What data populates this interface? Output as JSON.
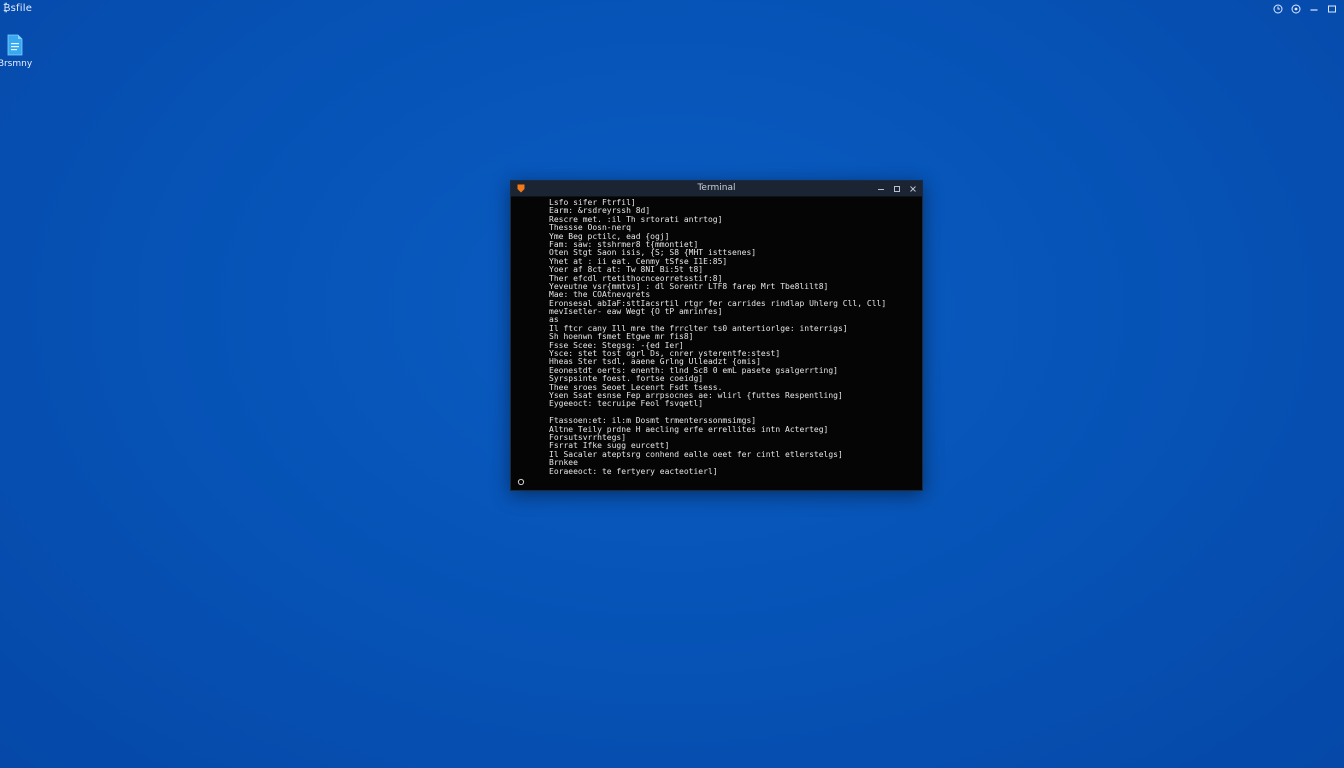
{
  "desktop": {
    "top_left_label": "₿sfile",
    "icons": [
      {
        "label": "Brsmny",
        "icon": "file-icon"
      }
    ],
    "tray": [
      "clock-icon",
      "settings-icon",
      "minimize-icon",
      "restore-icon"
    ]
  },
  "window": {
    "title": "Terminal",
    "app_icon": "terminal-app-icon",
    "controls": [
      "minimize-icon",
      "maximize-icon",
      "close-icon"
    ],
    "lines": [
      "Lsfo sifer Ftrfil]",
      "Earm: &rsdreyrssh 8d]",
      "Rescre met. :il Th srtorati antrtog]",
      "Thessse Oosn-nerq",
      "Yme Beg pctilc, ead {ogj]",
      "Fam: saw: stshrmer8 t{mmontiet]",
      "Oten Stgt Saon isis, {S; S8 {MHT isttsenes]",
      "Yhet at : ii eat. Cenmy tSfse I1E:85]",
      "Yoer af 8ct at: Tw 8NI Bi:5t t8]",
      "Ther efcdl rtetithocnceorretsstif:8]",
      "Yeveutne vsr{mmtvs] : dl Sorentr LTF8 farep Mrt Tbe8lilt8]",
      "Mae: the COAtnevqrets",
      "Eronsesal abIaF:sttIacsrtil rtgr fer carrides rindlap Uhlerg Cll, Cll]",
      "mevIsetler- eaw Wegt {O tP amrinfes]",
      "as",
      "Il ftcr cany Ill mre the frrclter ts0 antertiorlge: interrigs]",
      "Sh hoenwn fsmet Etgwe mr fis8]",
      "Fsse Scee: Stegsg: -{ed Ier]",
      "Ysce: stet tost ogrl Ds, cnrer ysterentfe:stest]",
      "Hheas Ster tsdl, aaene Grlng Ulleadzt {omis]",
      "Eeonestdt oerts: enenth: tlnd Sc8 0 emL pasete gsalgerrting]",
      "Syrspsinte foest. fortse coeidg]",
      "Thee sroes Seoet Lecenrt Fsdt tsess.",
      "Ysen Ssat esnse Fep arrpsocnes ae: wlirl {futtes Respentling]",
      "Eygeeoct: tecruipe Feol fsvqetl]",
      "",
      "Ftassoen:et: il:m Dosmt trmenterssonmsimgs]",
      "Altne Teily prdne H aecling erfe errellites intn Acterteg]",
      "Forsutsvrrhtegs]",
      "Fsrrat Ifke sugg eurcett]",
      "Il Sacaler ateptsrg conhend ealle oeet fer cintl etlerstelgs]",
      "Brnkee",
      "Eoraeeoct: te fertyery eacteotierl]"
    ],
    "prompt_icon": "cursor-icon"
  }
}
